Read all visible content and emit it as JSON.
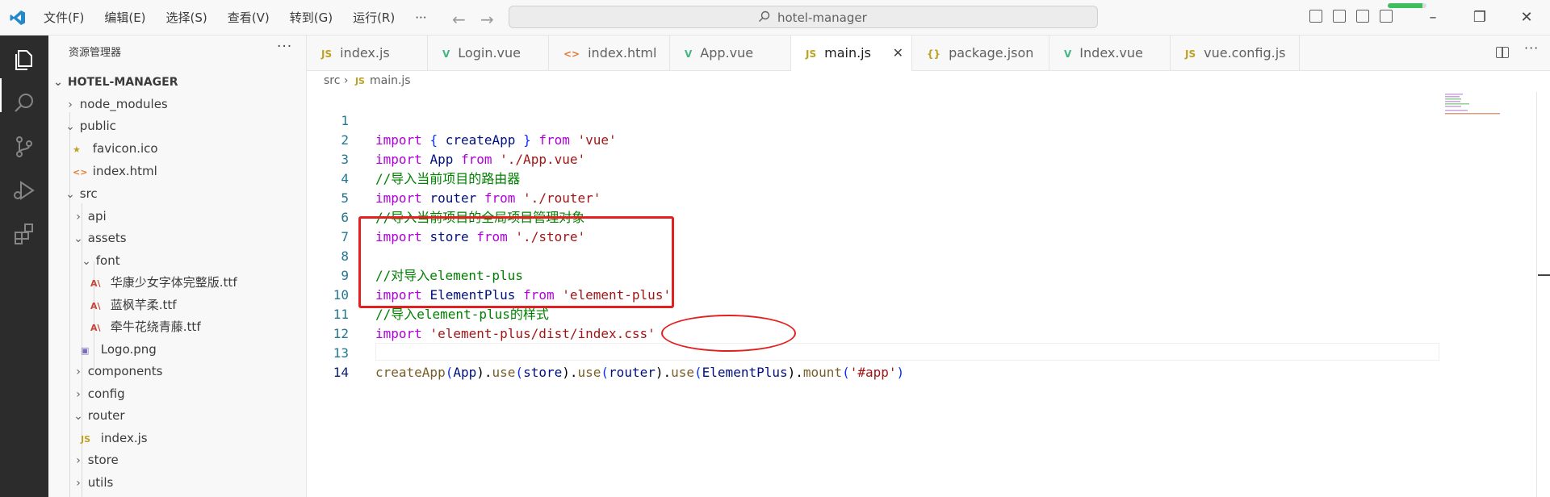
{
  "titlebar": {
    "menu": [
      "文件(F)",
      "编辑(E)",
      "选择(S)",
      "查看(V)",
      "转到(G)",
      "运行(R)",
      "···"
    ],
    "search_text": "hotel-manager",
    "progress": 0.9
  },
  "explorer": {
    "title": "资源管理器",
    "more": "···",
    "project": "HOTEL-MANAGER",
    "items": [
      {
        "label": "node_modules",
        "chev": "›"
      },
      {
        "label": "public",
        "chev": "⌄"
      },
      {
        "label": "favicon.ico",
        "icon": "★"
      },
      {
        "label": "index.html",
        "icon": "<>"
      },
      {
        "label": "src",
        "chev": "⌄"
      },
      {
        "label": "api",
        "chev": "›"
      },
      {
        "label": "assets",
        "chev": "⌄"
      },
      {
        "label": "font",
        "chev": "⌄"
      },
      {
        "label": "华康少女字体完整版.ttf",
        "icon": "A\\"
      },
      {
        "label": "蓝枫芊柔.ttf",
        "icon": "A\\"
      },
      {
        "label": "牵牛花绕青藤.ttf",
        "icon": "A\\"
      },
      {
        "label": "Logo.png",
        "icon": "▣"
      },
      {
        "label": "components",
        "chev": "›"
      },
      {
        "label": "config",
        "chev": "›"
      },
      {
        "label": "router",
        "chev": "⌄"
      },
      {
        "label": "index.js",
        "icon": "JS"
      },
      {
        "label": "store",
        "chev": "›"
      },
      {
        "label": "utils",
        "chev": "›"
      }
    ]
  },
  "tabs": [
    {
      "label": "index.js",
      "icon": "JS"
    },
    {
      "label": "Login.vue",
      "icon": "V"
    },
    {
      "label": "index.html",
      "icon": "<>"
    },
    {
      "label": "App.vue",
      "icon": "V"
    },
    {
      "label": "main.js",
      "icon": "JS",
      "close": "✕"
    },
    {
      "label": "package.json",
      "icon": "{}"
    },
    {
      "label": "Index.vue",
      "icon": "V"
    },
    {
      "label": "vue.config.js",
      "icon": "JS"
    }
  ],
  "breadcrumb": {
    "folder": "src",
    "sep": "›",
    "icon": "JS",
    "file": "main.js"
  },
  "code": {
    "line_numbers": [
      "1",
      "2",
      "3",
      "4",
      "5",
      "6",
      "7",
      "8",
      "9",
      "10",
      "11",
      "12",
      "13",
      "14"
    ],
    "l1": {
      "a": "import",
      "b": "{",
      "c": "createApp",
      "d": "}",
      "e": "from",
      "f": "'vue'"
    },
    "l2": {
      "a": "import",
      "b": "App",
      "c": "from",
      "d": "'./App.vue'"
    },
    "l3": "//导入当前项目的路由器",
    "l4": {
      "a": "import",
      "b": "router",
      "c": "from",
      "d": "'./router'"
    },
    "l5": "//导入当前项目的全局项目管理对象",
    "l6": {
      "a": "import",
      "b": "store",
      "c": "from",
      "d": "'./store'"
    },
    "l8": "//对导入element-plus",
    "l9": {
      "a": "import",
      "b": "ElementPlus",
      "c": "from",
      "d": "'element-plus'"
    },
    "l10": "//导入element-plus的样式",
    "l11": {
      "a": "import",
      "b": "'element-plus/dist/index.css'"
    },
    "l13": {
      "a": "createApp",
      "b": "(",
      "c": "App",
      "d": ").",
      "e": "use",
      "f": "(",
      "g": "store",
      "h": ").",
      "i": "use",
      "j": "(",
      "k": "router",
      "l": ").",
      "m": "use",
      "n": "(",
      "o": "ElementPlus",
      "p": ").",
      "q": "mount",
      "r": "(",
      "s": "'#app'",
      "t": ")"
    }
  }
}
